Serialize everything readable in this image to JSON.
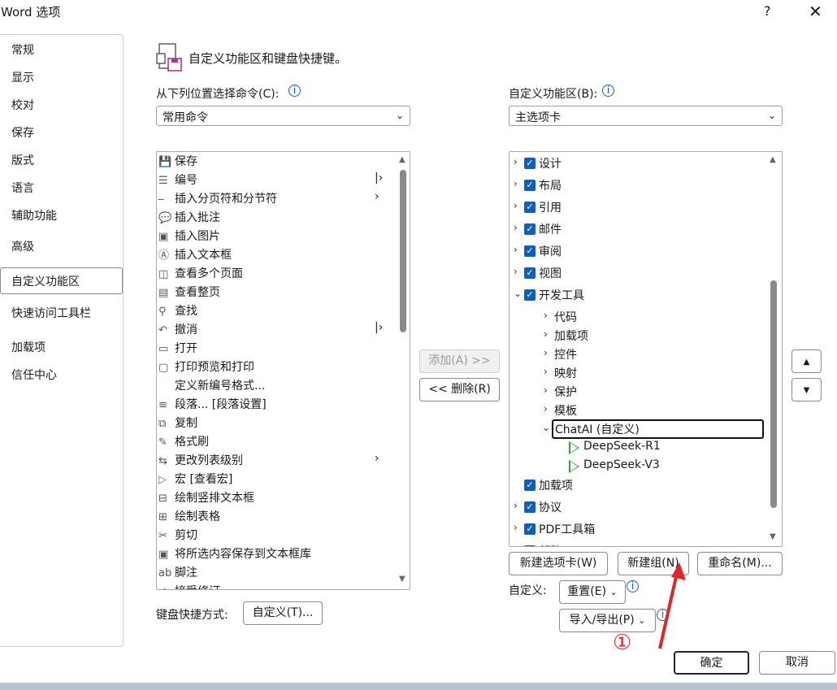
{
  "window": {
    "title": "Word 选项",
    "help": "?",
    "close": "✕"
  },
  "nav": {
    "items": [
      "常规",
      "显示",
      "校对",
      "保存",
      "版式",
      "语言",
      "辅助功能",
      "高级",
      "自定义功能区",
      "快速访问工具栏",
      "加载项",
      "信任中心"
    ]
  },
  "main": {
    "heading": "自定义功能区和键盘快捷键。"
  },
  "left": {
    "choose_label": "从下列位置选择命令(C):",
    "choose_value": "常用命令",
    "commands": [
      {
        "label": "保存",
        "icon": "save-icon"
      },
      {
        "label": "编号",
        "icon": "numbering-icon",
        "arrow": "|›"
      },
      {
        "label": "插入分页符和分节符",
        "icon": "page-break-icon",
        "arrow": "›"
      },
      {
        "label": "插入批注",
        "icon": "comment-icon"
      },
      {
        "label": "插入图片",
        "icon": "picture-icon"
      },
      {
        "label": "插入文本框",
        "icon": "textbox-icon"
      },
      {
        "label": "查看多个页面",
        "icon": "pages-icon"
      },
      {
        "label": "查看整页",
        "icon": "page-icon"
      },
      {
        "label": "查找",
        "icon": "find-icon"
      },
      {
        "label": "撤消",
        "icon": "undo-icon",
        "arrow": "|›"
      },
      {
        "label": "打开",
        "icon": "open-icon"
      },
      {
        "label": "打印预览和打印",
        "icon": "print-preview-icon"
      },
      {
        "label": "定义新编号格式...",
        "icon": ""
      },
      {
        "label": "段落... [段落设置]",
        "icon": "paragraph-icon"
      },
      {
        "label": "复制",
        "icon": "copy-icon"
      },
      {
        "label": "格式刷",
        "icon": "format-painter-icon"
      },
      {
        "label": "更改列表级别",
        "icon": "list-level-icon",
        "arrow": "›"
      },
      {
        "label": "宏 [查看宏]",
        "icon": "macro-icon"
      },
      {
        "label": "绘制竖排文本框",
        "icon": "vertical-textbox-icon"
      },
      {
        "label": "绘制表格",
        "icon": "draw-table-icon"
      },
      {
        "label": "剪切",
        "icon": "cut-icon"
      },
      {
        "label": "将所选内容保存到文本框库",
        "icon": "save-selection-icon"
      },
      {
        "label": "脚注",
        "icon": "footnote-icon"
      },
      {
        "label": "接受修订",
        "icon": "accept-icon"
      }
    ],
    "keyboard_label": "键盘快捷方式:",
    "keyboard_button": "自定义(T)..."
  },
  "middle": {
    "add": "添加(A) >>",
    "remove": "<< 删除(R)"
  },
  "right": {
    "customize_label": "自定义功能区(B):",
    "customize_value": "主选项卡",
    "tabs": [
      {
        "label": "设计",
        "state": "collapsed",
        "checked": true
      },
      {
        "label": "布局",
        "state": "collapsed",
        "checked": true
      },
      {
        "label": "引用",
        "state": "collapsed",
        "checked": true
      },
      {
        "label": "邮件",
        "state": "collapsed",
        "checked": true
      },
      {
        "label": "审阅",
        "state": "collapsed",
        "checked": true
      },
      {
        "label": "视图",
        "state": "collapsed",
        "checked": true
      },
      {
        "label": "开发工具",
        "state": "expanded",
        "checked": true
      }
    ],
    "groups": [
      "代码",
      "加载项",
      "控件",
      "映射",
      "保护",
      "模板"
    ],
    "custom_group": "ChatAI (自定义)",
    "custom_items": [
      "DeepSeek-R1",
      "DeepSeek-V3"
    ],
    "after": [
      {
        "label": "加载项",
        "expander": false,
        "checked": true
      },
      {
        "label": "协议",
        "expander": true,
        "checked": true
      },
      {
        "label": "PDF工具箱",
        "expander": true,
        "checked": true
      },
      {
        "label": "帮助",
        "expander": true,
        "checked": true
      }
    ],
    "new_tab": "新建选项卡(W)",
    "new_group": "新建组(N)",
    "rename": "重命名(M)...",
    "customize_text": "自定义:",
    "reset": "重置(E)",
    "import_export": "导入/导出(P)"
  },
  "annotation": {
    "marker": "①",
    "color": "#e0262b"
  },
  "footer": {
    "ok": "确定",
    "cancel": "取消"
  }
}
